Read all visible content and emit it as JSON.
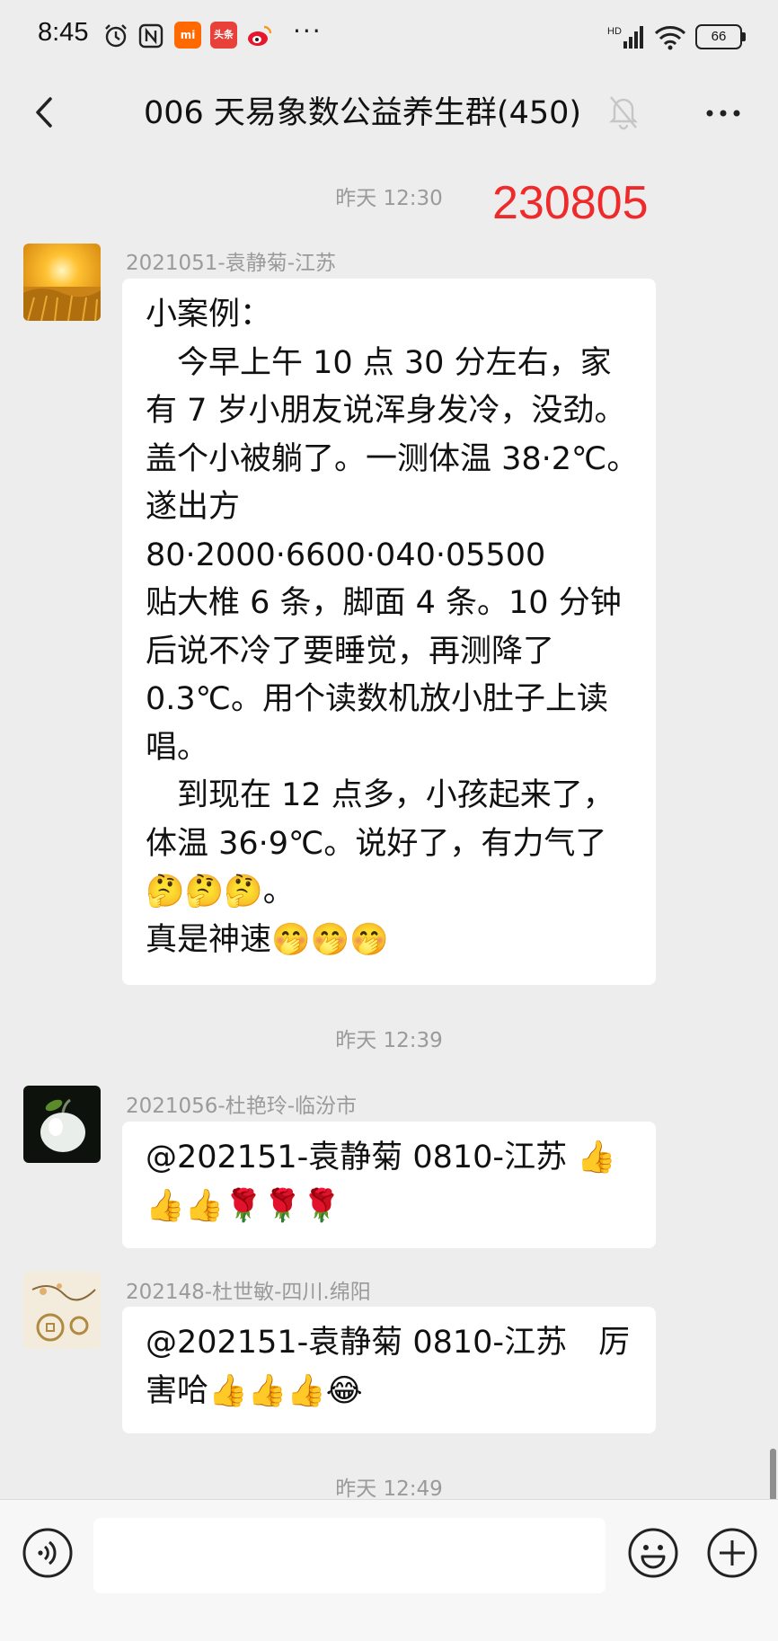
{
  "status_bar": {
    "time": "8:45",
    "app_badges": [
      "mi",
      "头条"
    ],
    "more": "···",
    "battery": "66"
  },
  "header": {
    "title": "006 天易象数公益养生群(450)"
  },
  "annotation": {
    "code": "230805",
    "color": "#ee2a2a"
  },
  "timestamps": [
    "昨天 12:30",
    "昨天 12:39",
    "昨天 12:49"
  ],
  "messages": [
    {
      "sender": "2021051-袁静菊-江苏",
      "lines": [
        "小案例：",
        "　今早上午 10 点 30 分左右，家",
        "有 7 岁小朋友说浑身发冷，没劲。",
        "盖个小被躺了。一测体温 38·2℃。",
        "遂出方",
        "80·2000·6600·040·05500",
        "贴大椎 6 条，脚面 4 条。10 分钟",
        "后说不冷了要睡觉，再测降了",
        "0.3℃。用个读数机放小肚子上读",
        "唱。",
        "　到现在 12 点多，小孩起来了，",
        "体温 36·9℃。说好了，有力气了",
        "🤔🤔🤔。",
        "真是神速🤭🤭🤭"
      ]
    },
    {
      "sender": "2021056-杜艳玲-临汾市",
      "lines": [
        "@202151-袁静菊 0810-江苏 👍",
        "👍👍🌹🌹🌹"
      ]
    },
    {
      "sender": "202148-杜世敏-四川.绵阳",
      "lines": [
        "@202151-袁静菊 0810-江苏　厉",
        "害哈👍👍👍😂"
      ]
    }
  ],
  "input": {
    "value": ""
  },
  "colors": {
    "background": "#ededed",
    "bubble": "#ffffff",
    "meta_text": "#9a9a9a",
    "bottom_bar": "#f7f7f7"
  }
}
